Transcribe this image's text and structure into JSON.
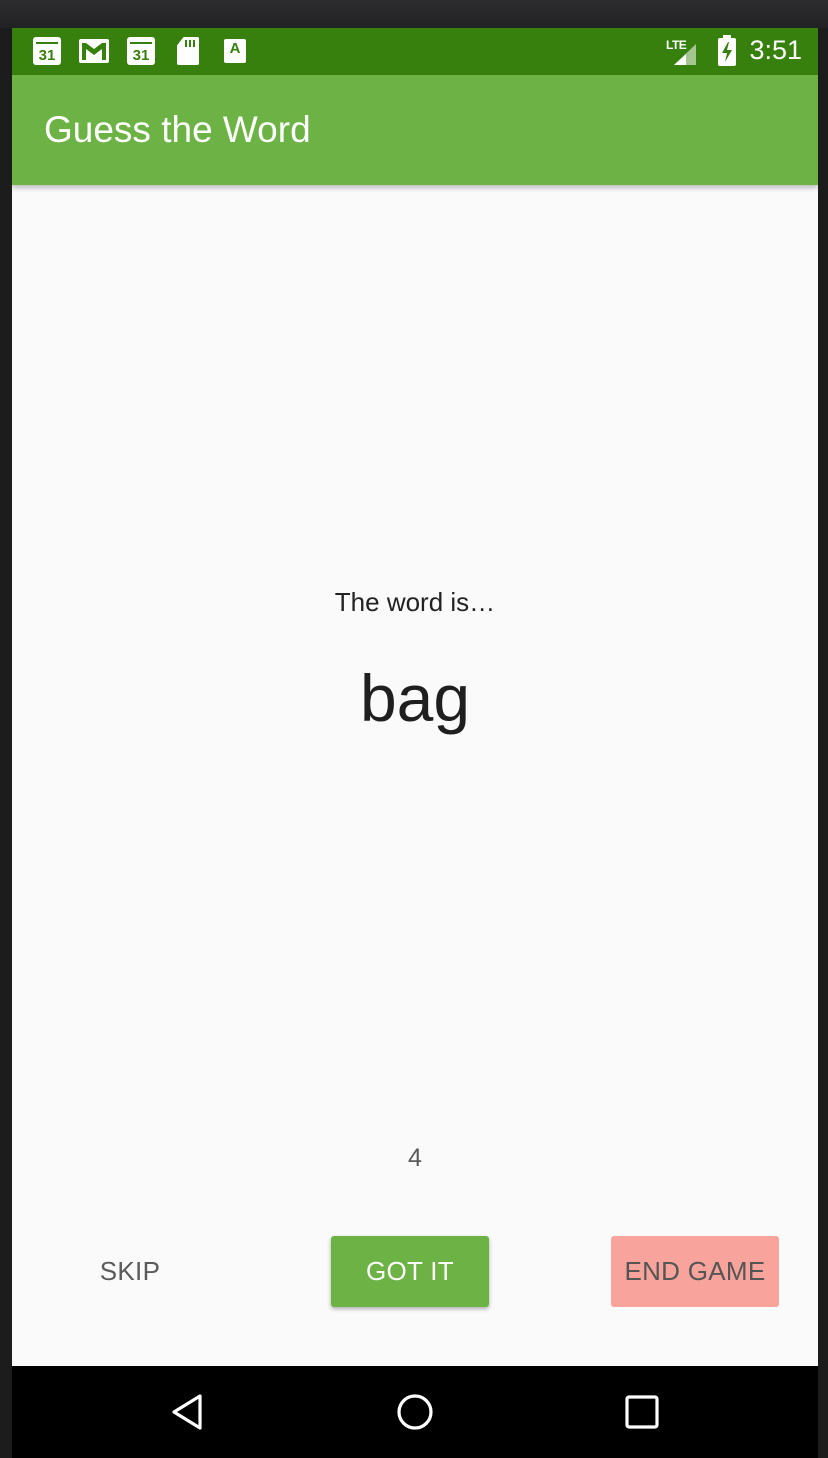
{
  "status_bar": {
    "time": "3:51",
    "network": "LTE",
    "notifications": [
      {
        "icon": "calendar-icon",
        "text": "31"
      },
      {
        "icon": "gmail-icon"
      },
      {
        "icon": "calendar-icon",
        "text": "31"
      },
      {
        "icon": "sd-card-icon"
      },
      {
        "icon": "font-a-icon",
        "text": "A"
      }
    ],
    "bar_color": "#38800d"
  },
  "app_bar": {
    "title": "Guess the Word",
    "color": "#6db245"
  },
  "game": {
    "prompt": "The word is…",
    "word": "bag",
    "timer": "4"
  },
  "buttons": {
    "skip": "SKIP",
    "got_it": "GOT IT",
    "end_game": "END GAME"
  },
  "nav_bar": {
    "back": "back-icon",
    "home": "home-icon",
    "recents": "recents-icon"
  }
}
